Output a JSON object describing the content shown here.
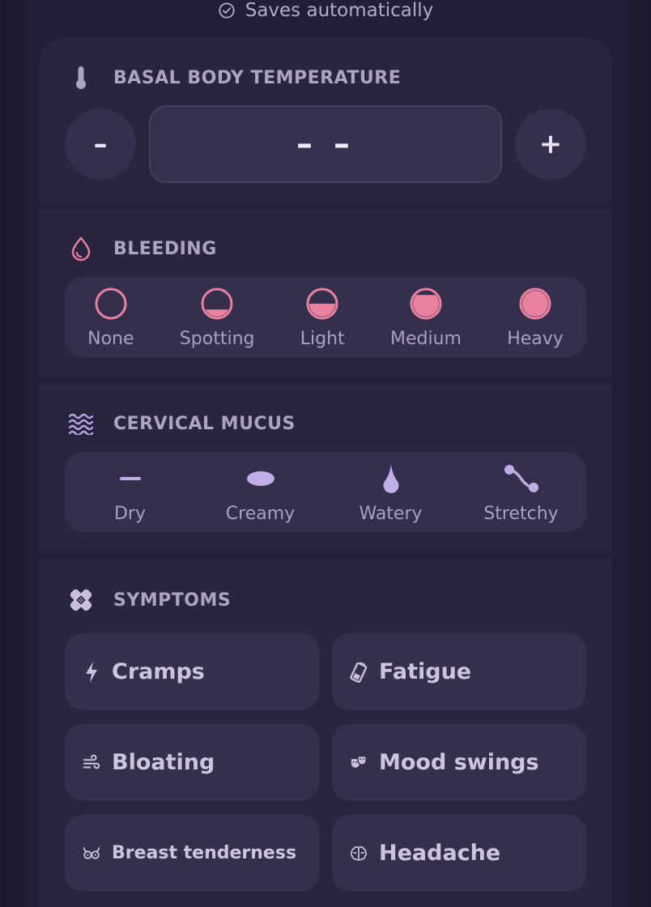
{
  "status": {
    "saves_text": "Saves automatically"
  },
  "temperature": {
    "title": "BASAL BODY TEMPERATURE",
    "value": "– –",
    "minus_label": "–",
    "plus_label": "+"
  },
  "bleeding": {
    "title": "BLEEDING",
    "options": [
      {
        "label": "None",
        "level": 0
      },
      {
        "label": "Spotting",
        "level": 0.3
      },
      {
        "label": "Light",
        "level": 0.5
      },
      {
        "label": "Medium",
        "level": 0.8
      },
      {
        "label": "Heavy",
        "level": 1
      }
    ]
  },
  "mucus": {
    "title": "CERVICAL MUCUS",
    "options": [
      {
        "label": "Dry",
        "icon": "dash-icon"
      },
      {
        "label": "Creamy",
        "icon": "oval-icon"
      },
      {
        "label": "Watery",
        "icon": "droplet-icon"
      },
      {
        "label": "Stretchy",
        "icon": "stretch-icon"
      }
    ]
  },
  "symptoms": {
    "title": "SYMPTOMS",
    "items": [
      {
        "label": "Cramps",
        "icon": "bolt-icon"
      },
      {
        "label": "Fatigue",
        "icon": "battery-low-icon"
      },
      {
        "label": "Bloating",
        "icon": "wind-icon"
      },
      {
        "label": "Mood swings",
        "icon": "masks-icon"
      },
      {
        "label": "Breast tenderness",
        "icon": "breast-icon"
      },
      {
        "label": "Headache",
        "icon": "brain-icon"
      }
    ]
  },
  "colors": {
    "accent_pink": "#e8829f",
    "accent_lavender": "#c0aee6",
    "card_bg": "#2a2440",
    "control_bg": "#352e4c"
  }
}
